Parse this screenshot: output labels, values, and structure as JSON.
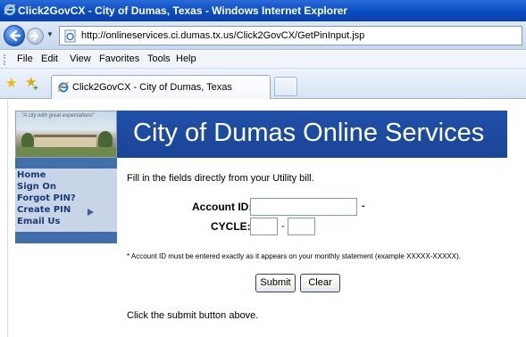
{
  "window": {
    "title": "Click2GovCX - City of Dumas, Texas - Windows Internet Explorer"
  },
  "address_bar": {
    "url": "http://onlineservices.ci.dumas.tx.us/Click2GovCX/GetPinInput.jsp"
  },
  "menu": {
    "items": [
      "File",
      "Edit",
      "View",
      "Favorites",
      "Tools",
      "Help"
    ]
  },
  "tabs": {
    "active_label": "Click2GovCX - City of Dumas, Texas"
  },
  "header": {
    "motto": "\"A city with great expectations\"",
    "banner_title": "City of Dumas Online Services"
  },
  "sidebar": {
    "items": [
      {
        "label": "Home"
      },
      {
        "label": "Sign On"
      },
      {
        "label": "Forgot PIN?"
      },
      {
        "label": "Create PIN"
      },
      {
        "label": "Email Us"
      }
    ]
  },
  "main": {
    "intro": "Fill in the fields directly from your Utility bill.",
    "account_label": "Account ID:",
    "account_value": "",
    "dash1": "-",
    "cycle_label": "CYCLE:",
    "cycle_value_1": "",
    "dash2": "-",
    "cycle_value_2": "",
    "note": "* Account ID must be entered exactly as it appears on your monthly statement (example XXXXX-XXXXX).",
    "submit_label": "Submit",
    "clear_label": "Clear",
    "footer_text": "Click the submit button above."
  },
  "colors": {
    "banner": "#1e4ea2",
    "sidebar_bg": "#c8d5e6",
    "sidebar_text": "#1a3a7a",
    "titlebar": "#0a4bc0"
  }
}
